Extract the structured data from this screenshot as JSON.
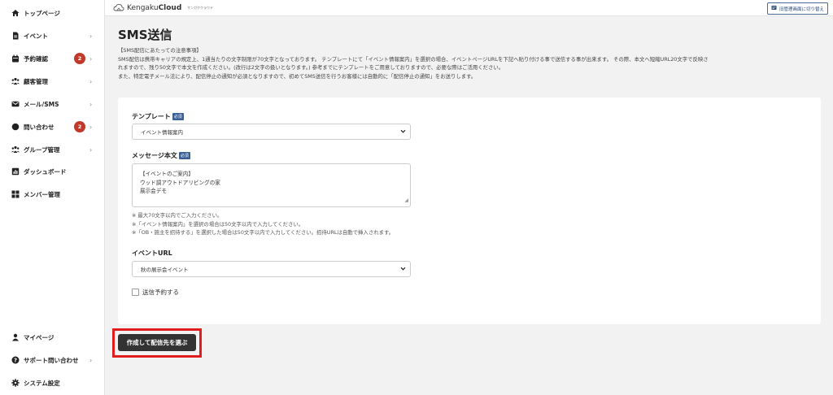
{
  "sidebar": {
    "items": [
      {
        "label": "トップページ",
        "icon": "home-icon"
      },
      {
        "label": "イベント",
        "icon": "document-icon",
        "chevron": "›"
      },
      {
        "label": "予約確認",
        "icon": "calendar-icon",
        "badge": "2",
        "chevron": "›"
      },
      {
        "label": "顧客管理",
        "icon": "users-icon",
        "chevron": "›"
      },
      {
        "label": "メール/SMS",
        "icon": "mail-icon",
        "chevron": "›"
      },
      {
        "label": "問い合わせ",
        "icon": "chat-icon",
        "badge": "2",
        "chevron": "›"
      },
      {
        "label": "グループ管理",
        "icon": "group-icon",
        "chevron": "›"
      },
      {
        "label": "ダッシュボード",
        "icon": "chart-icon"
      },
      {
        "label": "メンバー管理",
        "icon": "grid-icon"
      }
    ],
    "bottom_items": [
      {
        "label": "マイページ",
        "icon": "person-icon"
      },
      {
        "label": "サポート問い合わせ",
        "icon": "help-icon",
        "chevron": "›"
      },
      {
        "label": "システム設定",
        "icon": "gear-icon"
      }
    ]
  },
  "header": {
    "logo_text_light": "Kengaku",
    "logo_text_bold": "Cloud",
    "logo_sub": "ケンガククラウド",
    "switch_button": "旧管理画面に切り替え"
  },
  "page": {
    "title": "SMS送信",
    "notice_lines": [
      "【SMS配信にあたっての注意事項】",
      "SMS配信は携帯キャリアの規定上、1通当たりの文字制限が70文字となっております。 テンプレートにて「イベント情報案内」を選択の場合、イベントページURLを下記へ貼り付ける事で送信する事が出来ます。 その際、本文へ短縮URL20文字で反映さ",
      "れますので、残り50文字で本文を作成ください。(改行は2文字の扱いとなります。) 参考までにテンプレートをご用意しておりますので、必要な際はご活用ください。",
      "また、特定電子メール法により、配信停止の通知が必須となりますので、初めてSMS送信を行うお客様には自動的に「配信停止の通知」をお送りします。"
    ]
  },
  "form": {
    "required_badge": "必須",
    "template_label": "テンプレート",
    "template_value": "イベント情報案内",
    "message_label": "メッセージ本文",
    "message_lines": [
      "【イベントのご案内】",
      "ウッド調アウトドアリビングの家",
      "展示会デモ"
    ],
    "hints": [
      "※ 最大70文字以内でご入力ください。",
      "※「イベント情報案内」を選択の場合は50文字以内で入力してください。",
      "※「OB・施主を招待する」を選択した場合は50文字以内で入力してください。招待URLは自動で挿入されます。"
    ],
    "event_url_label": "イベントURL",
    "event_url_value": "秋の展示会イベント",
    "schedule_label": "送信予約する",
    "submit_label": "作成して配信先を選ぶ"
  },
  "colors": {
    "badge": "#c0392b",
    "required": "#3a5f94",
    "button": "#333333",
    "highlight": "#e01e1e"
  }
}
